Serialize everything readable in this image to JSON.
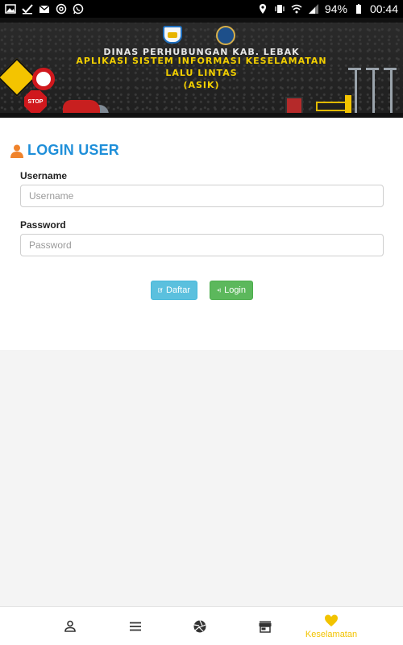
{
  "status_bar": {
    "battery": "94%",
    "time": "00:44",
    "left_icons": [
      "gallery-icon",
      "checkmark-icon",
      "gmail-icon",
      "at-sign-icon",
      "whatsapp-icon"
    ],
    "right_icons": [
      "location-icon",
      "vibrate-icon",
      "wifi-icon",
      "signal-icon",
      "battery-icon"
    ]
  },
  "banner": {
    "line1": "DINAS PERHUBUNGAN KAB. LEBAK",
    "line2": "APLIKASI SISTEM INFORMASI KESELAMATAN",
    "line3": "LALU LINTAS",
    "line4": "(ASIK)",
    "stop_sign": "STOP"
  },
  "login": {
    "title": "LOGIN USER",
    "title_color": "#1f8fd9",
    "icon_color": "#f0832b",
    "username_label": "Username",
    "username_placeholder": "Username",
    "username_value": "",
    "password_label": "Password",
    "password_placeholder": "Password",
    "password_value": "",
    "daftar_button": "Daftar",
    "login_button": "Login"
  },
  "bottom_nav": {
    "items": [
      {
        "icon": "person-icon",
        "label": ""
      },
      {
        "icon": "menu-icon",
        "label": ""
      },
      {
        "icon": "aperture-icon",
        "label": ""
      },
      {
        "icon": "store-icon",
        "label": ""
      },
      {
        "icon": "heart-icon",
        "label": "Keselamatan",
        "active": true
      }
    ],
    "active_color": "#f2c300"
  }
}
